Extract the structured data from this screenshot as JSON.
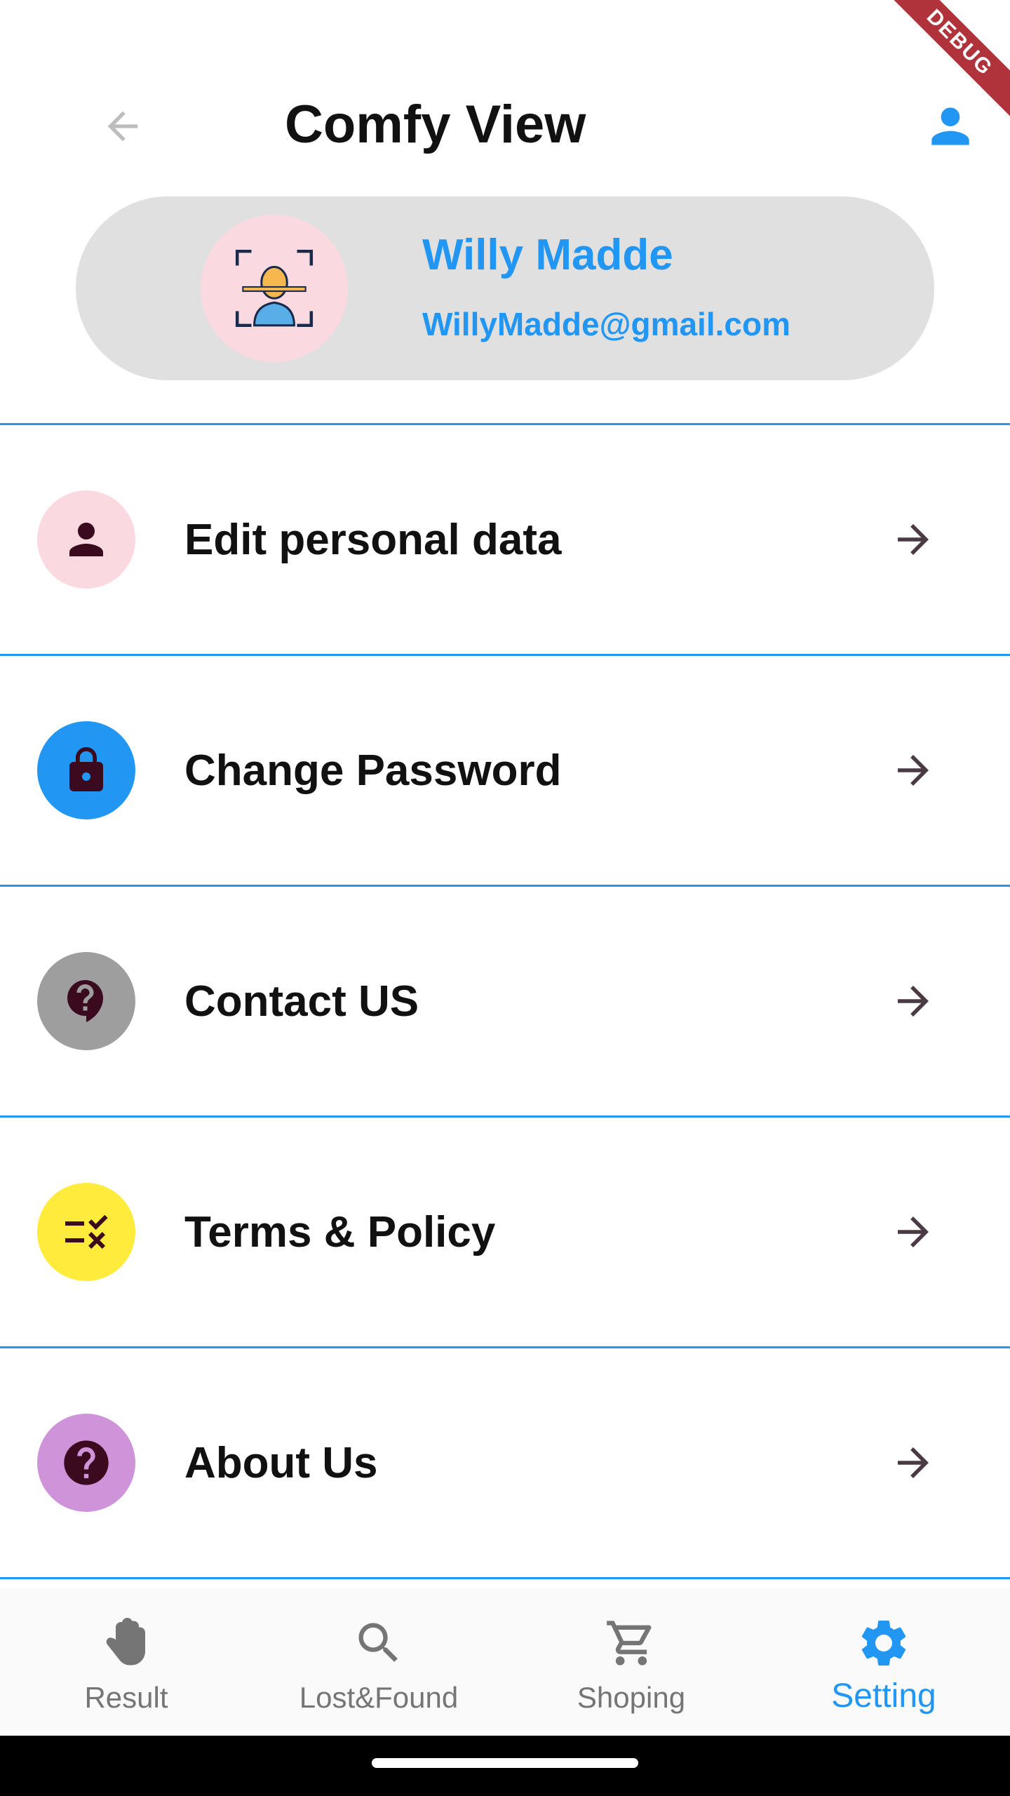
{
  "header": {
    "title": "Comfy View",
    "back_icon": "arrow-back-icon",
    "profile_icon": "person-icon",
    "debug_banner": "DEBUG"
  },
  "profile": {
    "name": "Willy Madde",
    "email": "WillyMadde@gmail.com",
    "avatar_icon": "face-scan-icon"
  },
  "menu": {
    "items": [
      {
        "label": "Edit personal data",
        "icon": "person-icon",
        "icon_bg": "#fbd9e1"
      },
      {
        "label": "Change Password",
        "icon": "lock-icon",
        "icon_bg": "#2196f3"
      },
      {
        "label": "Contact US",
        "icon": "help-bubble-icon",
        "icon_bg": "#9e9e9e"
      },
      {
        "label": "Terms & Policy",
        "icon": "rule-icon",
        "icon_bg": "#ffeb3b"
      },
      {
        "label": "About Us",
        "icon": "help-circle-icon",
        "icon_bg": "#ce93d8"
      }
    ],
    "arrow_icon": "arrow-forward-icon"
  },
  "bottom_nav": {
    "items": [
      {
        "label": "Result",
        "icon": "hand-icon"
      },
      {
        "label": "Lost&Found",
        "icon": "search-icon"
      },
      {
        "label": "Shoping",
        "icon": "cart-icon"
      },
      {
        "label": "Setting",
        "icon": "gear-icon",
        "active": true
      }
    ]
  },
  "colors": {
    "accent": "#2196f3",
    "divider": "#2196f3",
    "card_bg": "#e0e0e0",
    "icon_dark": "#3a0a1f"
  }
}
